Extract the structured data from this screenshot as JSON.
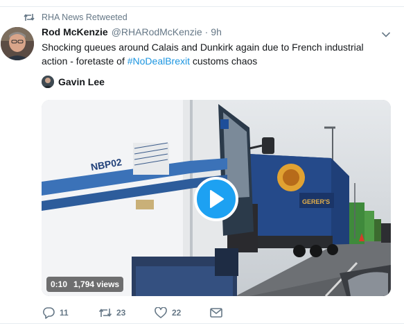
{
  "retweet": {
    "icon": "retweet-icon",
    "label": "RHA News Retweeted"
  },
  "tweet": {
    "author_name": "Rod McKenzie",
    "author_handle": "@RHARodMcKenzie",
    "separator": "·",
    "time": "9h",
    "text_before": "Shocking queues around Calais and Dunkirk again due to French industrial action - foretaste of ",
    "hashtag": "#NoDealBrexit",
    "text_after": " customs chaos"
  },
  "quote": {
    "author_name": "Gavin Lee"
  },
  "media": {
    "duration": "0:10",
    "views": "1,794 views",
    "truck_plate": "NBP02",
    "trailer_logo": "GERER'S"
  },
  "actions": {
    "reply_count": "11",
    "retweet_count": "23",
    "like_count": "22"
  },
  "colors": {
    "link": "#1b95e0",
    "accent": "#1da1f2",
    "muted": "#657786"
  }
}
